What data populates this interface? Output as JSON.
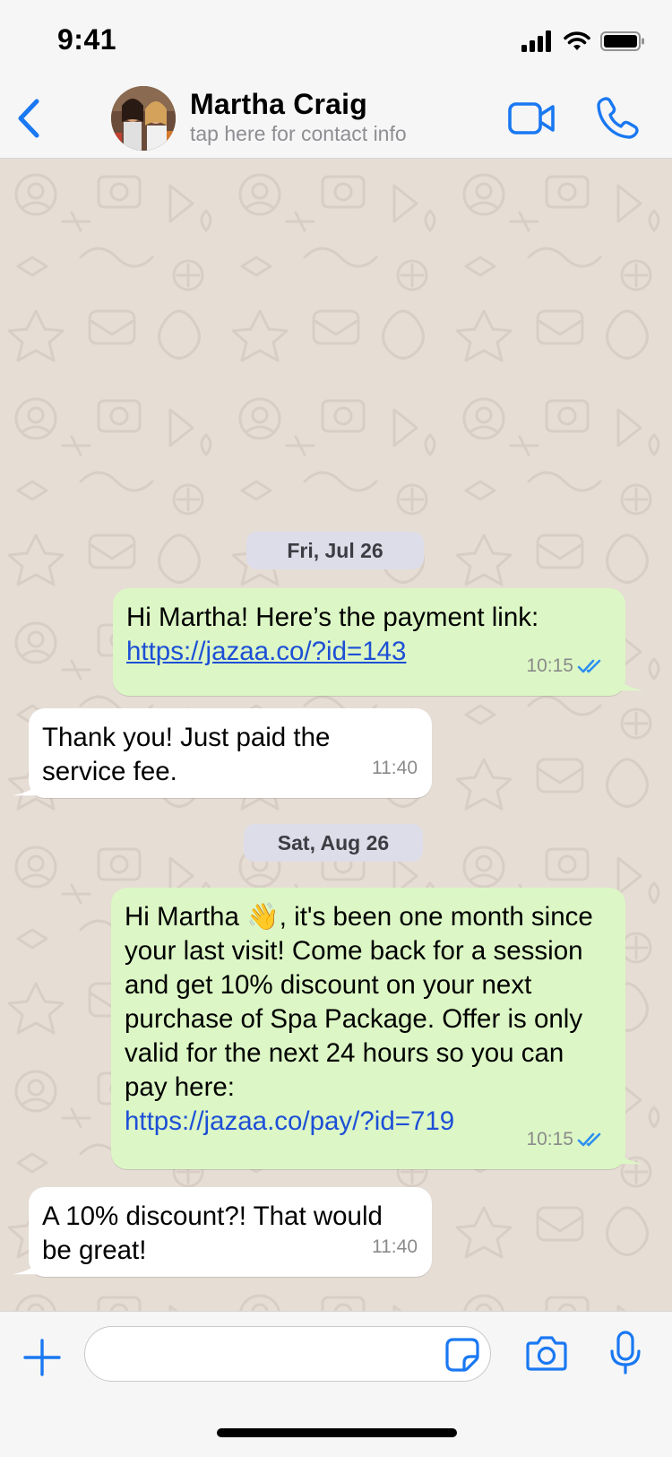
{
  "status_bar": {
    "time": "9:41"
  },
  "header": {
    "contact_name": "Martha Craig",
    "contact_sub": "tap here for contact info"
  },
  "messages": [
    {
      "type": "date",
      "text": "Fri, Jul 26"
    },
    {
      "type": "outgoing",
      "text_before": "Hi Martha! Here’s the payment link: ",
      "link": "https://jazaa.co/?id=143",
      "time": "10:15",
      "status": "read"
    },
    {
      "type": "incoming",
      "text": "Thank you! Just paid the service fee.",
      "time": "11:40"
    },
    {
      "type": "date",
      "text": "Sat, Aug 26"
    },
    {
      "type": "outgoing",
      "text_before": "Hi Martha 👋, it's been one month since your last visit! Come back for a session and get 10% discount on your next purchase of Spa Package. Offer is only valid for the next 24 hours so you can pay here:",
      "link": "https://jazaa.co/pay/?id=719",
      "time": "10:15",
      "status": "read"
    },
    {
      "type": "incoming",
      "text": "A 10% discount?! That would be great!",
      "time": "11:40"
    }
  ],
  "input": {
    "placeholder": ""
  },
  "colors": {
    "accent": "#1a78f2",
    "outgoing_bubble": "#dcf7c5",
    "incoming_bubble": "#ffffff",
    "chat_background": "#e6ddd5",
    "read_ticks": "#2d8ff0",
    "link": "#1d4fd6"
  },
  "icons": {
    "back": "chevron-left-icon",
    "video": "video-camera-icon",
    "call": "phone-icon",
    "plus": "plus-icon",
    "sticker": "sticker-icon",
    "camera": "camera-icon",
    "mic": "microphone-icon",
    "read_status": "double-check-icon"
  }
}
